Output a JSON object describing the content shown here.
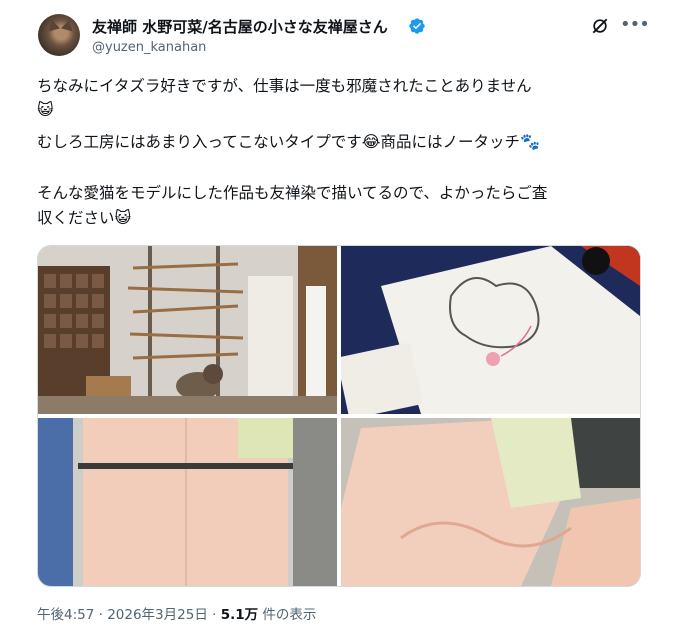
{
  "author": {
    "display_name": "友禅師 水野可菜/名古屋の小さな友禅屋さん",
    "handle": "@yuzen_kanahan"
  },
  "tweet": {
    "line1": "ちなみにイタズラ好きですが、仕事は一度も邪魔されたことありません",
    "line2_emoji": "😺",
    "line3a": "むしろ工房にはあまり入ってこないタイプです",
    "line3_emoji1": "😂",
    "line3b": "商品にはノータッチ",
    "line3_emoji2": "🐾",
    "line4": "そんな愛猫をモデルにした作品も友禅染で描いてるので、よかったらご査",
    "line5": "収ください",
    "line5_emoji": "😺"
  },
  "media": {
    "images": [
      "workshop-cat-photo",
      "cat-drawing-on-fabric-photo",
      "pink-kimono-photo",
      "kimono-fabric-photo"
    ]
  },
  "footer": {
    "time": "午後4:57",
    "sep1": " · ",
    "date": "2026年3月25日",
    "sep2": " · ",
    "views_count": "5.1万",
    "views_label": " 件の表示"
  },
  "colors": {
    "verified": "#1d9bf0",
    "secondary_text": "#536471"
  },
  "icons": [
    "verified-badge-icon",
    "grok-icon",
    "more-icon"
  ]
}
